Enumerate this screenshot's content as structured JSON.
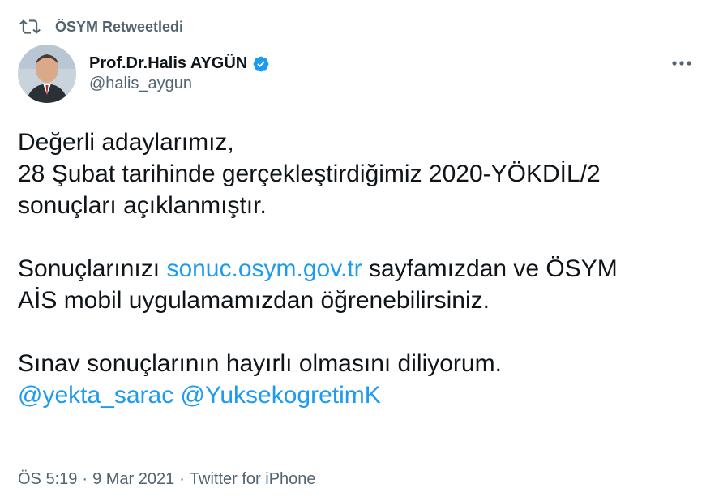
{
  "retweet": {
    "icon": "retweet-icon",
    "label": "ÖSYM Retweetledi"
  },
  "author": {
    "avatar_icon": "profile-avatar",
    "display_name": "Prof.Dr.Halis AYGÜN",
    "verified_icon": "verified-badge-icon",
    "handle": "@halis_aygun"
  },
  "more_icon": "more-options-icon",
  "tweet": {
    "line1": "Değerli adaylarımız,",
    "line2": "28 Şubat tarihinde gerçekleştirdiğimiz 2020-YÖKDİL/2",
    "line3": "sonuçları açıklanmıştır.",
    "p2_prefix": "Sonuçlarınızı ",
    "p2_link": "sonuc.osym.gov.tr",
    "p2_suffix_line1": " sayfamızdan ve ÖSYM",
    "p2_line2": "AİS mobil uygulamamızdan öğrenebilirsiniz.",
    "p3_line1": "Sınav sonuçlarının hayırlı olmasını diliyorum.",
    "mention1": "@yekta_sarac",
    "mention2": "@YuksekogretimK"
  },
  "meta": {
    "time": "ÖS 5:19",
    "sep1": "·",
    "date": "9 Mar 2021",
    "sep2": "·",
    "source": "Twitter for iPhone"
  },
  "colors": {
    "link": "#1d9bf0",
    "muted": "#536471",
    "text": "#0f1419",
    "verified": "#1d9bf0"
  }
}
